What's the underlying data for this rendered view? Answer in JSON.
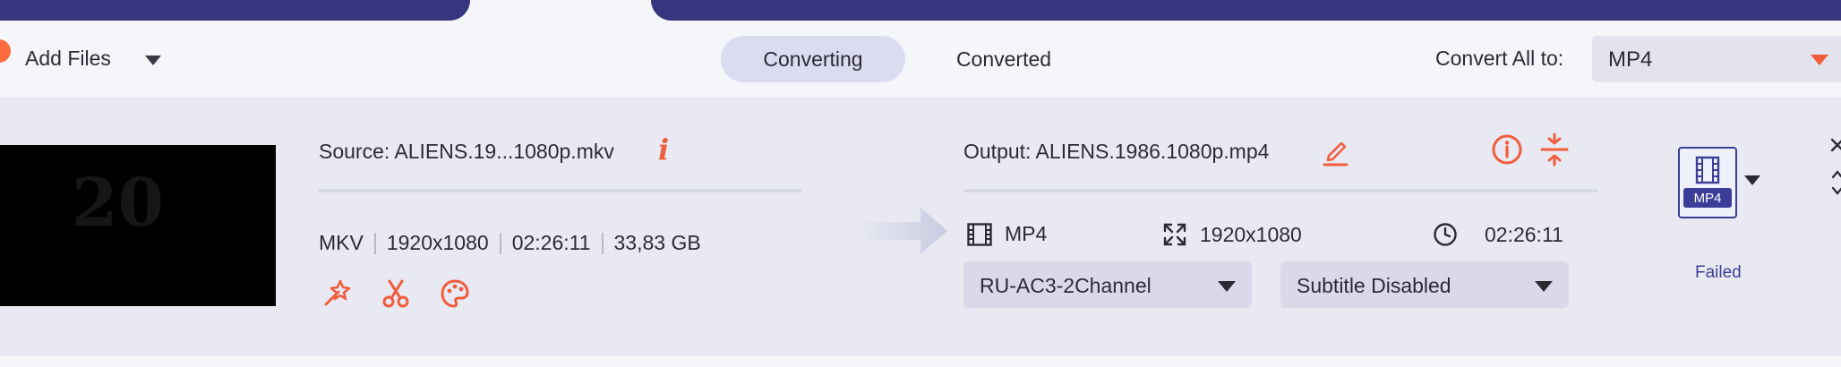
{
  "toolbar": {
    "add_files_label": "Add Files",
    "tabs": [
      {
        "label": "Converting",
        "active": true
      },
      {
        "label": "Converted",
        "active": false
      }
    ],
    "convert_all_label": "Convert All to:",
    "convert_all_value": "MP4"
  },
  "item": {
    "source": "Source: ALIENS.19...1080p.mkv",
    "meta": {
      "format": "MKV",
      "resolution": "1920x1080",
      "duration": "02:26:11",
      "size": "33,83 GB"
    },
    "output": "Output: ALIENS.1986.1080p.mp4",
    "output_specs": {
      "format": "MP4",
      "resolution": "1920x1080",
      "duration": "02:26:11"
    },
    "audio_track": "RU-AC3-2Channel",
    "subtitle": "Subtitle Disabled",
    "format_badge": "MP4",
    "status": "Failed"
  },
  "icons": {
    "add": "add-circle-icon",
    "info": "info-icon",
    "enhance": "magic-wand-icon",
    "cut": "scissors-icon",
    "effects": "palette-icon",
    "edit": "pencil-icon",
    "output_info": "info-circle-icon",
    "compress": "compress-icon",
    "film": "film-icon",
    "resize": "resize-icon",
    "clock": "clock-icon",
    "close": "close-icon",
    "reorder": "up-down-icon"
  },
  "colors": {
    "accent": "#f25c3c",
    "primary": "#353580",
    "status_failed": "#3a3e99"
  }
}
